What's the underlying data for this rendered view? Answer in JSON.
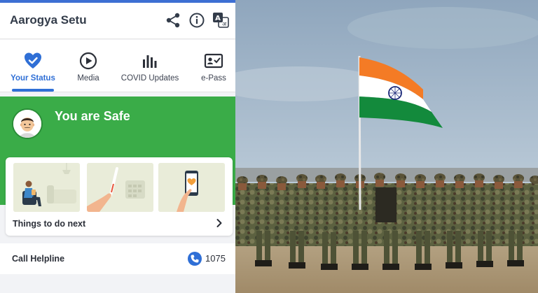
{
  "app": {
    "title": "Aarogya Setu",
    "accent_color": "#2f6fd6",
    "header_icons": [
      "share-icon",
      "info-icon",
      "language-icon"
    ]
  },
  "tabs": [
    {
      "label": "Your Status",
      "icon": "heart-check-icon",
      "active": true
    },
    {
      "label": "Media",
      "icon": "play-circle-icon",
      "active": false
    },
    {
      "label": "COVID Updates",
      "icon": "bar-chart-icon",
      "active": false
    },
    {
      "label": "e-Pass",
      "icon": "id-card-icon",
      "active": false
    }
  ],
  "status": {
    "text": "You are Safe",
    "color": "#3aac48",
    "avatar_icon": "user-avatar-icon"
  },
  "todo_card": {
    "label": "Things to do next",
    "illustrations": [
      "person-on-sofa-illustration",
      "thermometer-illustration",
      "phone-app-illustration"
    ]
  },
  "helpline": {
    "label": "Call Helpline",
    "number": "1075",
    "icon": "phone-icon"
  },
  "photo": {
    "subject": "soldiers-with-indian-flag-photo",
    "flag_colors": [
      "#f47b25",
      "#ffffff",
      "#138a3c"
    ]
  }
}
